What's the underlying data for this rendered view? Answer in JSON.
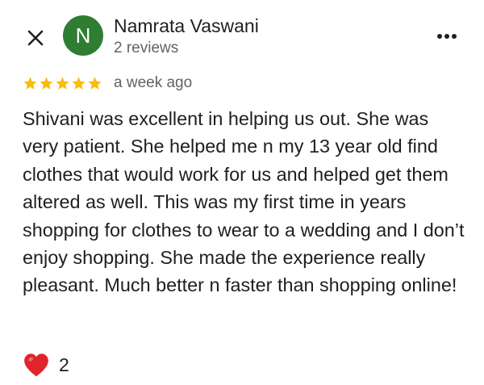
{
  "header": {
    "close_icon": "close-icon",
    "more_icon": "more-horizontal-icon"
  },
  "author": {
    "initial": "N",
    "avatar_color": "#2e7d32",
    "name": "Namrata Vaswani",
    "meta": "2 reviews"
  },
  "review": {
    "rating": 5,
    "max_rating": 5,
    "star_color": "#fbbc04",
    "date": "a week ago",
    "text": "Shivani was excellent in helping us out. She was very patient. She helped me n my 13 year old find clothes that would work for us and helped get them altered as well. This was my first time in years shopping for clothes to wear to a wedding and I don’t enjoy shopping. She made the experience really pleasant. Much better n faster than shopping online!"
  },
  "reactions": {
    "icon": "heart-icon",
    "heart_color": "#e0242a",
    "count": "2"
  }
}
